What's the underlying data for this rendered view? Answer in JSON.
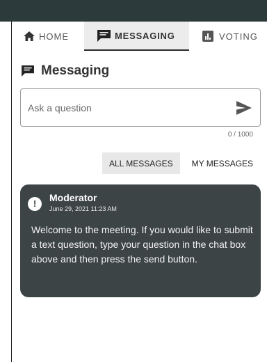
{
  "tabs": {
    "home": "HOME",
    "messaging": "MESSAGING",
    "voting": "VOTING"
  },
  "section_title": "Messaging",
  "ask": {
    "placeholder": "Ask a question",
    "value": ""
  },
  "counter": "0 / 1000",
  "filters": {
    "all": "ALL MESSAGES",
    "mine": "MY MESSAGES"
  },
  "messages": [
    {
      "author": "Moderator",
      "timestamp": "June 29, 2021 11:23 AM",
      "text": "Welcome to the meeting. If you would like to submit a text question, type your question in the chat box above and then press the send button.",
      "icon": "alert-icon"
    }
  ],
  "colors": {
    "topbar": "#2d3a3c",
    "message_bg": "#3d4446",
    "active_tab_bg": "#ececec"
  }
}
